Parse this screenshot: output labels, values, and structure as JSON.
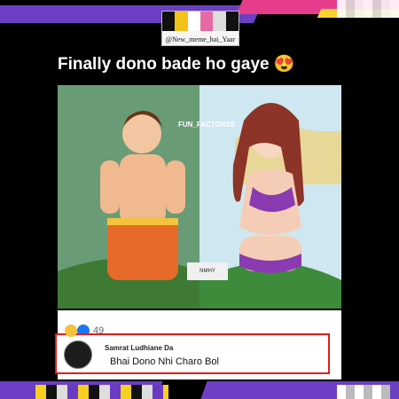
{
  "watermark": {
    "text": "@New_meme_hai_Yaar"
  },
  "post": {
    "headline": "Finally dono bade ho gaye",
    "headline_emoji": "😍",
    "image_tag": "FUN_FACTORSS",
    "image_watermark": "NMHY",
    "reaction_count": "49",
    "actions": {
      "like_count": "49",
      "comment_count": "12"
    }
  },
  "comment": {
    "author": "Samrat Ludhiane Da",
    "text": "Bhai Dono Nhi Charo Bol"
  },
  "colors": {
    "accent_purple": "#6c3fc4",
    "accent_pink": "#e73d8d",
    "highlight_red": "#e51b1b",
    "like_blue": "#1877f2"
  }
}
